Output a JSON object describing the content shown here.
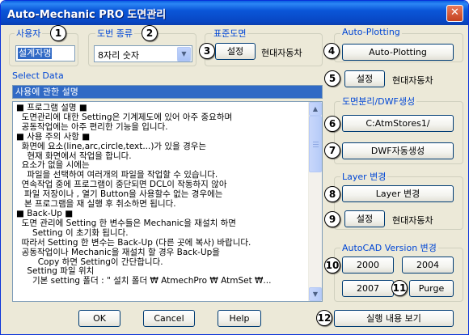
{
  "window": {
    "title": "Auto-Mechanic PRO 도면관리",
    "close_symbol": "✕"
  },
  "user": {
    "label": "사용자",
    "value": "설계자명"
  },
  "drawing_type": {
    "label": "도번 종류",
    "selected": "8자리 숫자",
    "arrow": "▼"
  },
  "standard_drawing": {
    "title": "표준도면",
    "set_button": "설정",
    "value": "현대자동차"
  },
  "auto_plotting": {
    "title": "Auto-Plotting",
    "button": "Auto-Plotting"
  },
  "select_data": {
    "label": "Select Data",
    "set_button": "설정",
    "value": "현대자동차",
    "header": "사용에 관한 설명",
    "lines": [
      "■ 프로그램 설명 ■",
      "  도면관리에 대한 Setting은 기계제도에 있어 아주 중요하며",
      "  공동작업에는 아주 편리한 기능을 입니다.",
      "■ 사용 주의 사항 ■",
      "  화면에 요소(line,arc,circle,text...)가 있을 경우는",
      "    현재 화면에서 작업을 합니다.",
      "  요소가 없을 시에는",
      "    파일을 선택하여 여러개의 파일을 작업할 수 있습니다.",
      "  연속작업 중에 프로그램이 중단되면 DCL이 작동하지 않아",
      "   파일 저장이나 , 열기 Button을 사용할수 없는 경우에는",
      "   본 프로그램을 재 실행 후 취소하면 됩니다.",
      "■ Back-Up ■",
      "  도면 관리에 Setting 한 변수들은 Mechanic을 재설치 하면",
      "      Setting 이 초기화 됩니다.",
      "  따라서 Setting 한 변수는 Back-Up (다른 곳에 복사) 바랍니다.",
      "  공동작업이나 Mechanic을 재설치 할 경우 Back-Up을",
      "        Copy 하면 Setting이 간단합니다.",
      "    Setting 파일 위치",
      "      기본 setting 폴더 : \" 설치 폴더 ₩ AtmechPro ₩ AtmSet ₩..."
    ],
    "scroll_up": "▲",
    "scroll_down": "▼"
  },
  "drawing_split": {
    "title": "도면분리/DWF생성",
    "path_button": "C:AtmStores1/",
    "dwf_button": "DWF자동생성"
  },
  "layer_change": {
    "title": "Layer 변경",
    "button": "Layer 변경",
    "set_button": "설정",
    "value": "현대자동차"
  },
  "autocad_version": {
    "title": "AutoCAD Version 변경",
    "v2000": "2000",
    "v2004": "2004",
    "v2007": "2007",
    "purge": "Purge"
  },
  "footer": {
    "ok": "OK",
    "cancel": "Cancel",
    "help": "Help",
    "run_view": "실행 내용 보기"
  },
  "badges": [
    "1",
    "2",
    "3",
    "4",
    "5",
    "6",
    "7",
    "8",
    "9",
    "10",
    "11",
    "12"
  ]
}
